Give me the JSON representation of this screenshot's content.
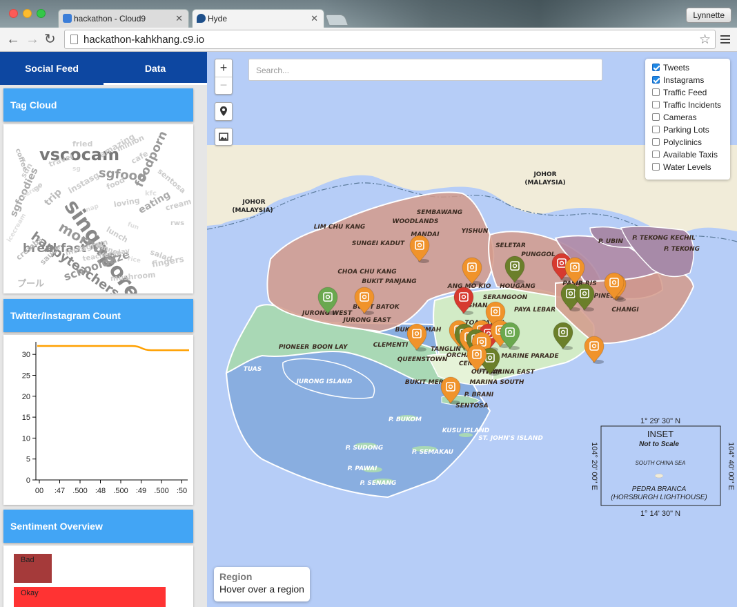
{
  "browser": {
    "tabs": [
      {
        "title": "hackathon - Cloud9",
        "active": false
      },
      {
        "title": "Hyde",
        "active": true
      }
    ],
    "user": "Lynnette",
    "url": "hackathon-kahkhang.c9.io"
  },
  "sidebar": {
    "tabs": [
      "Social Feed",
      "Data"
    ],
    "active_tab": "Data",
    "tag_cloud": {
      "title": "Tag Cloud",
      "words": [
        "singapore",
        "vscocam",
        "happyteachersday",
        "morning",
        "sgfood",
        "foodporn",
        "breakfast",
        "schooldaze",
        "sgfoodies",
        "eating",
        "trip",
        "instasg",
        "fried",
        "amazing",
        "travel",
        "minion",
        "cafe",
        "sentosa",
        "sun",
        "coffee",
        "food",
        "cream",
        "rws",
        "salad",
        "fingers",
        "mushroom",
        "crumbs",
        "sauce",
        "lunch",
        "instagram",
        "loving",
        "プール",
        "dinner",
        "go",
        "teachersday",
        "fun",
        "kfc",
        "cereal",
        "sg",
        "rice",
        "icecream",
        "nap"
      ]
    },
    "count_chart": {
      "title": "Twitter/Instagram Count"
    },
    "sentiment": {
      "title": "Sentiment Overview",
      "bars": [
        {
          "label": "Bad",
          "color": "#a53a3a"
        },
        {
          "label": "Okay",
          "color": "#ff3333"
        }
      ]
    }
  },
  "chart_data": {
    "type": "line",
    "title": "Twitter/Instagram Count",
    "x": [
      ":46.500",
      ":47",
      ":47.500",
      ":48",
      ":48.500",
      ":49",
      ":49.500",
      ":50",
      ":50.500"
    ],
    "x_tick_labels": [
      "00",
      ":47",
      ".500",
      ":48",
      ".500",
      ":49",
      ".500",
      ":50"
    ],
    "series": [
      {
        "values": [
          32,
          32,
          32,
          32,
          32,
          32,
          31,
          31,
          31
        ],
        "color": "#ffa000"
      }
    ],
    "yticks": [
      0,
      5,
      10,
      15,
      20,
      25,
      30
    ],
    "ylim": [
      0,
      33
    ]
  },
  "map": {
    "search_placeholder": "Search...",
    "zoom_in": "+",
    "zoom_out": "−",
    "layers": [
      {
        "label": "Tweets",
        "checked": true
      },
      {
        "label": "Instagrams",
        "checked": true
      },
      {
        "label": "Traffic Feed",
        "checked": false
      },
      {
        "label": "Traffic Incidents",
        "checked": false
      },
      {
        "label": "Cameras",
        "checked": false
      },
      {
        "label": "Parking Lots",
        "checked": false
      },
      {
        "label": "Polyclinics",
        "checked": false
      },
      {
        "label": "Available Taxis",
        "checked": false
      },
      {
        "label": "Water Levels",
        "checked": false
      }
    ],
    "region_title": "Region",
    "region_hint": "Hover over a region",
    "labels": {
      "johor_left": "JOHOR",
      "malaysia_left": "(MALAYSIA)",
      "johor_top": "JOHOR",
      "malaysia_top": "(MALAYSIA)",
      "sembawang": "SEMBAWANG",
      "woodlands": "WOODLANDS",
      "lim_chu_kang": "LIM CHU KANG",
      "sungei_kadut": "SUNGEI KADUT",
      "yishun": "YISHUN",
      "mandai": "MANDAI",
      "seletar": "SELETAR",
      "punggol": "PUNGGOL",
      "pasir_ris": "PASIR RIS",
      "tekong_kechil": "P. TEKONG KECHIL",
      "tekong": "P. TEKONG",
      "ubin": "P. UBIN",
      "choa_chu_kang": "CHOA CHU KANG",
      "bukit_panjang": "BUKIT PANJANG",
      "ang_mo_kio": "ANG MO KIO",
      "hougang": "HOUGANG",
      "serangoon": "SERANGOON",
      "tampines": "TAMPINES",
      "changi": "CHANGI",
      "paya_lebar": "PAYA LEBAR",
      "jurong_west": "JURONG WEST",
      "jurong_east": "JURONG EAST",
      "bukit_batok": "BUKIT BATOK",
      "bukit_timah": "BUKIT TIMAH",
      "toa_payoh": "TOA PAYOH",
      "bishan": "BISHAN",
      "pioneer": "PIONEER",
      "boon_lay": "BOON LAY",
      "clementi": "CLEMENTI",
      "tanglin": "TANGLIN",
      "orchard": "ORCHARD",
      "queenstown": "QUEENSTOWN",
      "marine_parade": "MARINE PARADE",
      "bukit_merah": "BUKIT MERAH",
      "outram": "OUTRAM",
      "marina_east": "MARINA EAST",
      "marina_south": "MARINA SOUTH",
      "central": "CENTRAL",
      "tuas": "TUAS",
      "jurong_island": "JURONG ISLAND",
      "sentosa": "SENTOSA",
      "p_brani": "P. BRANI",
      "p_bukom": "P. BUKOM",
      "kusu_island": "KUSU ISLAND",
      "st_johns": "ST. JOHN'S ISLAND",
      "p_sudong": "P. SUDONG",
      "p_semakau": "P. SEMAKAU",
      "p_pawai": "P. PAWAI",
      "p_senang": "P. SENANG"
    },
    "inset": {
      "lat_top": "1° 29' 30\" N",
      "lat_bottom": "1° 14' 30\" N",
      "lon_left": "104° 20' 00\" E",
      "lon_right": "104° 40' 00\" E",
      "title": "INSET",
      "subtitle": "Not to Scale",
      "sea": "SOUTH CHINA SEA",
      "place": "PEDRA BRANCA",
      "place_sub": "(HORSBURGH LIGHTHOUSE)"
    },
    "marker_colors": {
      "instagram": "#f0932b",
      "tweet_neutral": "#6b7f2a",
      "tweet_positive": "#6aa84f",
      "tweet_negative": "#d63a2f"
    }
  }
}
